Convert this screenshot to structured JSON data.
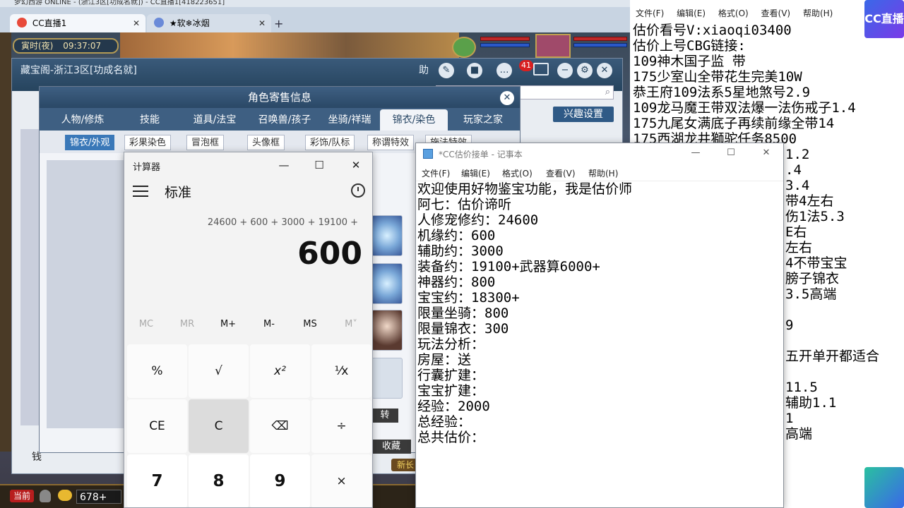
{
  "window_title": "梦幻西游 ONLINE - (浙江3区[功成名就]) - CC直播1[418223651]",
  "browser_tabs": [
    {
      "label": "CC直播1",
      "active": true
    },
    {
      "label": "★软❄冰烟",
      "active": false
    }
  ],
  "game": {
    "time_label": "寅时(夜)",
    "clock": "09:37:07",
    "bottom": {
      "current_btn": "当前",
      "online_count": "678+",
      "newbie_tag": "新长"
    }
  },
  "cbg": {
    "title": "藏宝阁-浙江3区[功成名就]",
    "helper_label": "助",
    "badge_count": "41",
    "interest_btn": "兴趣设置",
    "gold_label": "钱"
  },
  "role_dialog": {
    "title": "角色寄售信息",
    "tabs": [
      "人物/修炼",
      "技能",
      "道具/法宝",
      "召唤兽/孩子",
      "坐骑/祥瑞",
      "锦衣/染色",
      "玩家之家"
    ],
    "active_tab_index": 5,
    "subtabs": [
      "锦衣/外观",
      "彩果染色",
      "冒泡框",
      "头像框",
      "彩饰/队标",
      "称谓特效",
      "施法特效"
    ],
    "active_subtab_index": 0,
    "btn_zhuan": "转",
    "btn_fav": "收藏"
  },
  "calculator": {
    "app_name": "计算器",
    "mode": "标准",
    "expression": "24600 + 600 + 3000 + 19100 +",
    "result": "600",
    "memory_keys": [
      "MC",
      "MR",
      "M+",
      "M-",
      "MS",
      "M˅"
    ],
    "memory_disabled": [
      true,
      true,
      false,
      false,
      false,
      true
    ],
    "keys": [
      "%",
      "√",
      "x²",
      "¹⁄x",
      "CE",
      "C",
      "⌫",
      "÷",
      "7",
      "8",
      "9",
      "×"
    ]
  },
  "notepad": {
    "title": "*CC估价接单 - 记事本",
    "menus": [
      "文件(F)",
      "编辑(E)",
      "格式(O)",
      "查看(V)",
      "帮助(H)"
    ],
    "lines": [
      "欢迎使用好物鉴宝功能，我是估价师",
      "阿七：估价谛听",
      "人修宠修约：24600",
      "机缘约：600",
      "辅助约：3000",
      "装备约：19100+武器算6000+",
      "神器约：800",
      "宝宝约：18300+",
      "限量坐骑：800",
      "限量锦衣：300",
      "玩法分析：",
      "房屋：送",
      "行囊扩建：",
      "宝宝扩建：",
      "经验：2000",
      "总经验：",
      "总共估价："
    ]
  },
  "bg_notepad": {
    "menus": [
      "文件(F)",
      "编辑(E)",
      "格式(O)",
      "查看(V)",
      "帮助(H)"
    ],
    "lines_full": [
      "估价看号V:xiaoqi03400",
      "估价上号CBG链接:",
      "109神木国子监 带",
      "175少室山全带花生完美10W",
      "恭王府109法系5星地煞号2.9",
      "109龙马魔王带双法爆一法伤戒子1.4",
      "175九尾女满底子再续前缘全带14",
      "175西湖龙井獅驼任务8500"
    ],
    "lines_clipped": [
      "1.2",
      ".4",
      "3.4",
      "带4左右",
      "伤1法5.3",
      "E右",
      "左右",
      "4不带宝宝",
      "膀子锦衣",
      "3.5高端",
      "",
      "9",
      "",
      "五开单开都适合",
      "",
      "11.5",
      "辅助1.1",
      "1",
      "高端"
    ],
    "watermark": "CC直播"
  }
}
